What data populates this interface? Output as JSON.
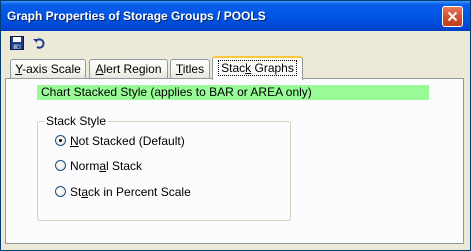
{
  "window": {
    "title": "Graph Properties of Storage Groups / POOLS"
  },
  "toolbar": {
    "save_icon": "floppy-disk-icon",
    "undo_icon": "undo-icon"
  },
  "tabs": [
    {
      "label_pre": "Y",
      "label_ul": "",
      "label_post": "-axis Scale",
      "active": false
    },
    {
      "label_pre": "",
      "label_ul": "A",
      "label_post": "lert Region",
      "active": false
    },
    {
      "label_pre": "",
      "label_ul": "T",
      "label_post": "itles",
      "active": false
    },
    {
      "label_pre": "Stac",
      "label_ul": "k",
      "label_post": " Graphs",
      "active": true
    }
  ],
  "info": {
    "text": "Chart Stacked Style (applies to BAR or AREA only)"
  },
  "stack_style": {
    "legend": "Stack Style",
    "options": [
      {
        "pre": "",
        "ul": "N",
        "post": "ot Stacked (Default)",
        "selected": true
      },
      {
        "pre": "Norm",
        "ul": "a",
        "post": "l Stack",
        "selected": false
      },
      {
        "pre": "St",
        "ul": "a",
        "post": "ck in Percent Scale",
        "selected": false
      }
    ]
  },
  "colors": {
    "title_bar": "#0055e5",
    "info_bar": "#98fb98",
    "close_button": "#d4502e",
    "active_tab_highlight": "#ffc73c"
  }
}
